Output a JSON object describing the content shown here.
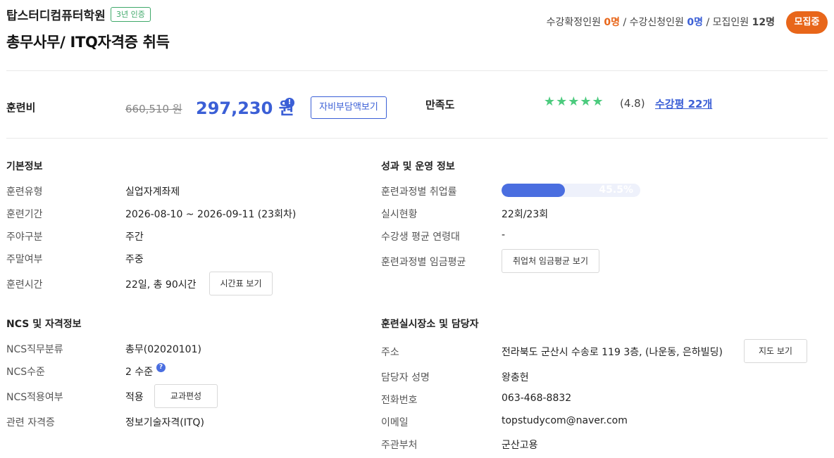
{
  "header": {
    "academy": "탑스터디컴퓨터학원",
    "cert_badge": "3년 인증",
    "course_title": "총무사무/ ITQ자격증 취득",
    "counts": {
      "confirmed_label": "수강확정인원",
      "confirmed_value": "0명",
      "applied_label": "수강신청인원",
      "applied_value": "0명",
      "recruit_label": "모집인원",
      "recruit_value": "12명",
      "sep": "/"
    },
    "status": "모집중"
  },
  "price": {
    "label": "훈련비",
    "original": "660,510 원",
    "sale": "297,230 원",
    "info_icon": "!",
    "self_pay_button": "자비부담액보기"
  },
  "satisfaction": {
    "label": "만족도",
    "stars": 4.8,
    "stars_glyph": "★★★★★",
    "rating_text": "(4.8)",
    "review_link": "수강평 22개"
  },
  "basic_info": {
    "title": "기본정보",
    "rows": [
      {
        "label": "훈련유형",
        "value": "실업자계좌제"
      },
      {
        "label": "훈련기간",
        "value": "2026-08-10 ~ 2026-09-11 (23회차)"
      },
      {
        "label": "주야구분",
        "value": "주간"
      },
      {
        "label": "주말여부",
        "value": "주중"
      },
      {
        "label": "훈련시간",
        "value": "22일, 총 90시간"
      }
    ],
    "timetable_button": "시간표 보기"
  },
  "performance": {
    "title": "성과 및 운영 정보",
    "rows": [
      {
        "label": "훈련과정별 취업률",
        "value": "45.5%"
      },
      {
        "label": "실시현황",
        "value": "22회/23회"
      },
      {
        "label": "수강생 평균 연령대",
        "value": "-"
      },
      {
        "label": "훈련과정별 임금평균",
        "value": ""
      }
    ],
    "employment_rate": 0.455,
    "wage_button": "취업처 임금평균 보기"
  },
  "ncs": {
    "title": "NCS 및 자격정보",
    "rows": [
      {
        "label": "NCS직무분류",
        "value": "총무(02020101)"
      },
      {
        "label": "NCS수준",
        "value": "2 수준"
      },
      {
        "label": "NCS적용여부",
        "value": "적용"
      },
      {
        "label": "관련 자격증",
        "value": "정보기술자격(ITQ)"
      }
    ],
    "help_icon": "?",
    "curriculum_button": "교과편성"
  },
  "location": {
    "title": "훈련실시장소 및 담당자",
    "rows": [
      {
        "label": "주소",
        "value": "전라북도 군산시 수송로 119 3층, (나운동, 은하빌딩)"
      },
      {
        "label": "담당자 성명",
        "value": "왕충헌"
      },
      {
        "label": "전화번호",
        "value": "063-468-8832"
      },
      {
        "label": "이메일",
        "value": "topstudycom@naver.com"
      },
      {
        "label": "주관부처",
        "value": "군산고용"
      }
    ],
    "map_button": "지도 보기"
  },
  "colors": {
    "accent_blue": "#3b5fd6",
    "accent_orange": "#e8661a",
    "star_green": "#4ccb7e",
    "cert_green": "#3fa96a"
  }
}
